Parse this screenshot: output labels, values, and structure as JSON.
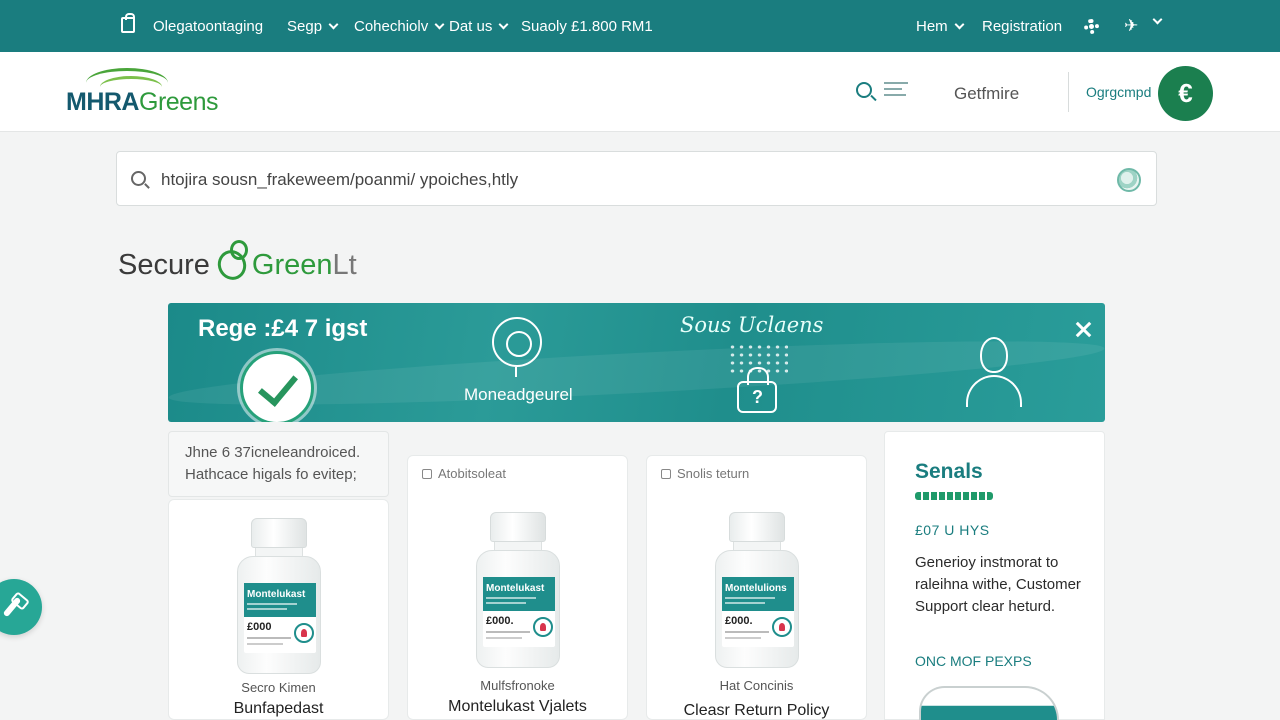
{
  "nav": {
    "items": [
      {
        "label": "Olegatoontaging",
        "has_caret": false
      },
      {
        "label": "Segp",
        "has_caret": true
      },
      {
        "label": "Cohechiolv",
        "has_caret": true
      },
      {
        "label": "Dat us",
        "has_caret": true
      },
      {
        "label": "Suaoly £1.800 RM1",
        "has_caret": false
      }
    ],
    "right_items": [
      {
        "label": "Hem",
        "has_caret": true
      },
      {
        "label": "Registration",
        "has_caret": false
      }
    ]
  },
  "header": {
    "logo_part1": "MHRA",
    "logo_part2": "Greens",
    "get_in": "Getfmire",
    "orig": "Ogrgcmpd",
    "euro_symbol": "€"
  },
  "urlbar": {
    "text": "htojira sousn_frakeweem/poanmi/ ypoiches,htly"
  },
  "brand": {
    "part1": "Secure",
    "part2": "Green",
    "part3": "Lt"
  },
  "banner": {
    "title": "Rege :£4 7 igst",
    "mid_label": "Moneadgeurel",
    "script_text": "Sous Uclaens"
  },
  "notice": {
    "line1": "Jhne 6 37icneleandroiced.",
    "line2": "Hathcace higals fo evitep;"
  },
  "products": [
    {
      "tag": "",
      "bottle_label": "Montelukast",
      "price": "£000",
      "sub": "Secro Kimen",
      "name": "Bunfapedast"
    },
    {
      "tag": "Atobitsoleat",
      "bottle_label": "Montelukast",
      "price": "£000.",
      "sub": "Mulfsfronoke",
      "name": "Montelukast Vjalets"
    },
    {
      "tag": "Snolis teturn",
      "bottle_label": "Montelulions",
      "price": "£000.",
      "sub": "Hat Concinis",
      "name": "Cleasr Return Policy"
    }
  ],
  "side_panel": {
    "title": "Senals",
    "code": "£07 U HYS",
    "desc": "Generioy instmorat to raleihna withe, Customer Support clear heturd.",
    "link": "ONC MOF PEXPS"
  },
  "colors": {
    "teal": "#1a7d7f",
    "green": "#2e9a3c"
  }
}
